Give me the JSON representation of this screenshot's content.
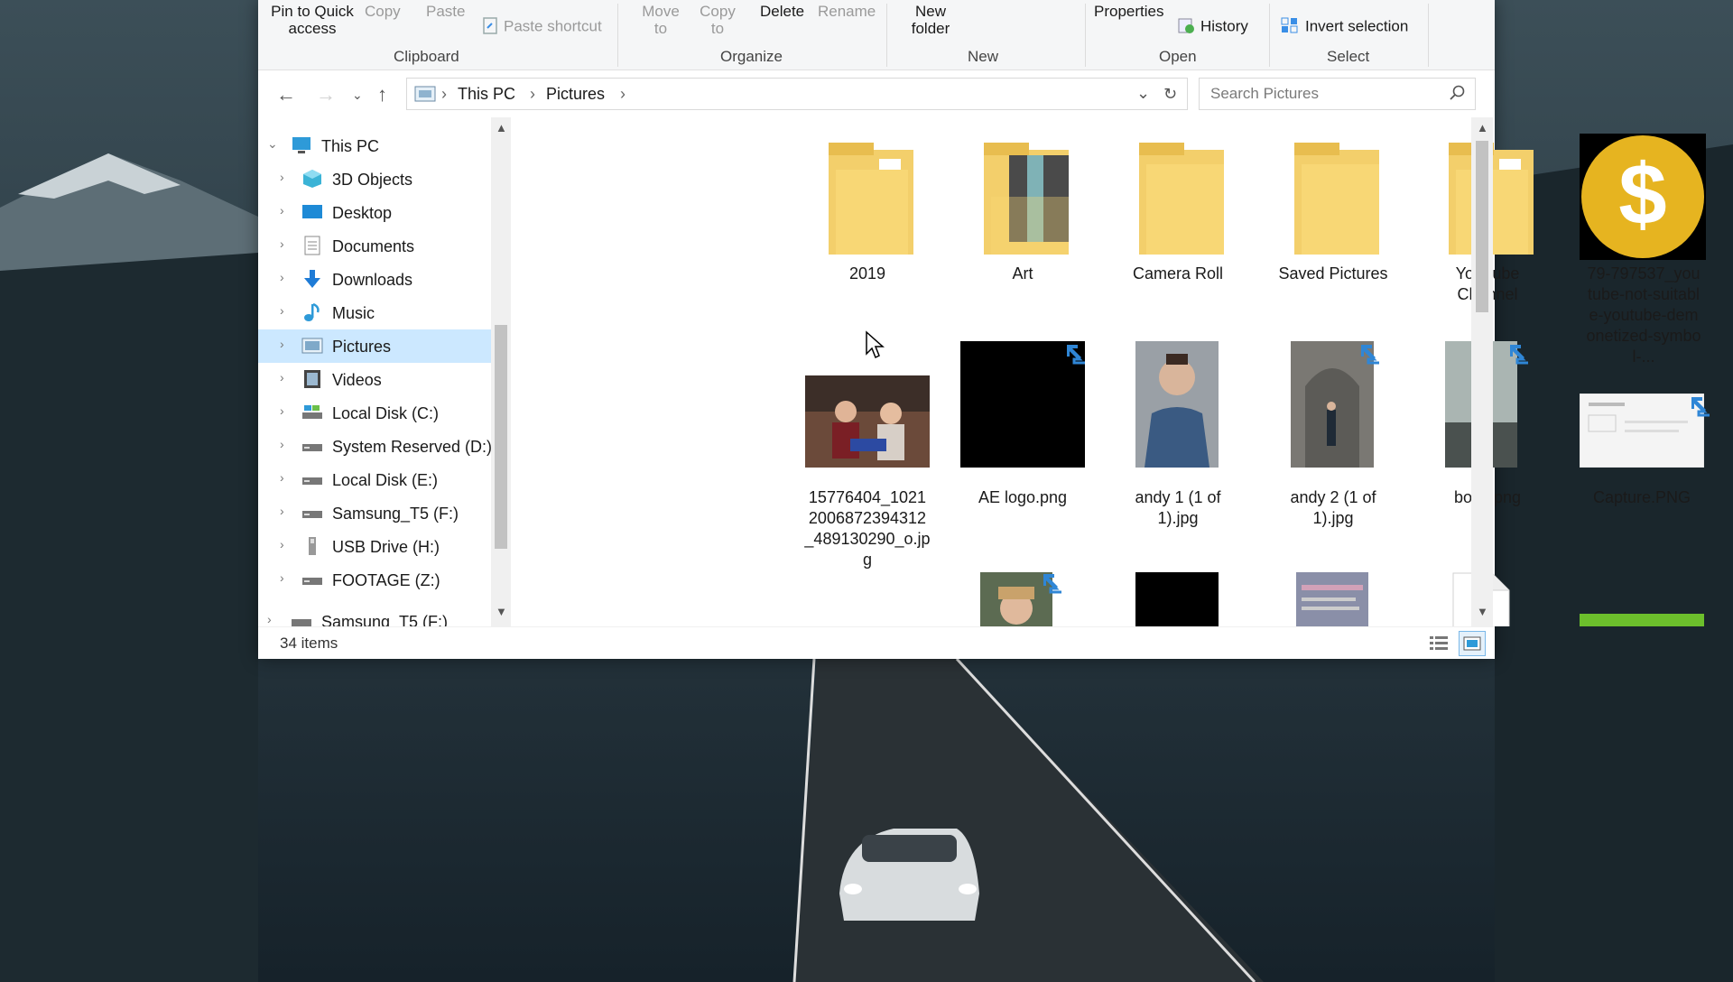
{
  "ribbon": {
    "pin_label": "Pin to Quick access",
    "copy_label": "Copy",
    "paste_label": "Paste",
    "paste_shortcut_label": "Paste shortcut",
    "move_to_label": "Move to",
    "copy_to_label": "Copy to",
    "delete_label": "Delete",
    "rename_label": "Rename",
    "new_folder_label": "New folder",
    "properties_label": "Properties",
    "history_label": "History",
    "invert_selection_label": "Invert selection",
    "groups": [
      "Clipboard",
      "Organize",
      "New",
      "Open",
      "Select"
    ]
  },
  "address": {
    "crumbs": [
      "This PC",
      "Pictures"
    ],
    "search_placeholder": "Search Pictures"
  },
  "sidebar": {
    "items": [
      {
        "label": "This PC",
        "icon": "computer-icon"
      },
      {
        "label": "3D Objects",
        "icon": "cube-icon"
      },
      {
        "label": "Desktop",
        "icon": "desktop-icon"
      },
      {
        "label": "Documents",
        "icon": "document-icon"
      },
      {
        "label": "Downloads",
        "icon": "download-icon"
      },
      {
        "label": "Music",
        "icon": "music-icon"
      },
      {
        "label": "Pictures",
        "icon": "pictures-icon"
      },
      {
        "label": "Videos",
        "icon": "video-icon"
      },
      {
        "label": "Local Disk (C:)",
        "icon": "drive-icon"
      },
      {
        "label": "System Reserved (D:)",
        "icon": "drive-icon"
      },
      {
        "label": "Local Disk (E:)",
        "icon": "drive-icon"
      },
      {
        "label": "Samsung_T5 (F:)",
        "icon": "drive-icon"
      },
      {
        "label": "USB Drive (H:)",
        "icon": "usb-drive-icon"
      },
      {
        "label": "FOOTAGE (Z:)",
        "icon": "drive-icon"
      },
      {
        "label": "Samsung_T5 (F:)",
        "icon": "drive-icon"
      }
    ]
  },
  "files": [
    {
      "name": "2019",
      "kind": "folder"
    },
    {
      "name": "Art",
      "kind": "folder"
    },
    {
      "name": "Camera Roll",
      "kind": "folder"
    },
    {
      "name": "Saved Pictures",
      "kind": "folder"
    },
    {
      "name": "YouTube Channel",
      "kind": "folder"
    },
    {
      "name": "79-797537_youtube-not-suitable-youtube-demonetized-symbol-...",
      "kind": "image"
    },
    {
      "name": "15776404_10212006872394312_489130290_o.jpg",
      "kind": "image"
    },
    {
      "name": "AE logo.png",
      "kind": "image"
    },
    {
      "name": "andy 1 (1 of 1).jpg",
      "kind": "image"
    },
    {
      "name": "andy 2 (1 of 1).jpg",
      "kind": "image"
    },
    {
      "name": "boyd.png",
      "kind": "image"
    },
    {
      "name": "Capture.PNG",
      "kind": "image"
    }
  ],
  "status": {
    "item_count": "34 items"
  },
  "colors": {
    "selection": "#cce8ff",
    "folder": "#f8d775",
    "accent": "#0078d7"
  }
}
